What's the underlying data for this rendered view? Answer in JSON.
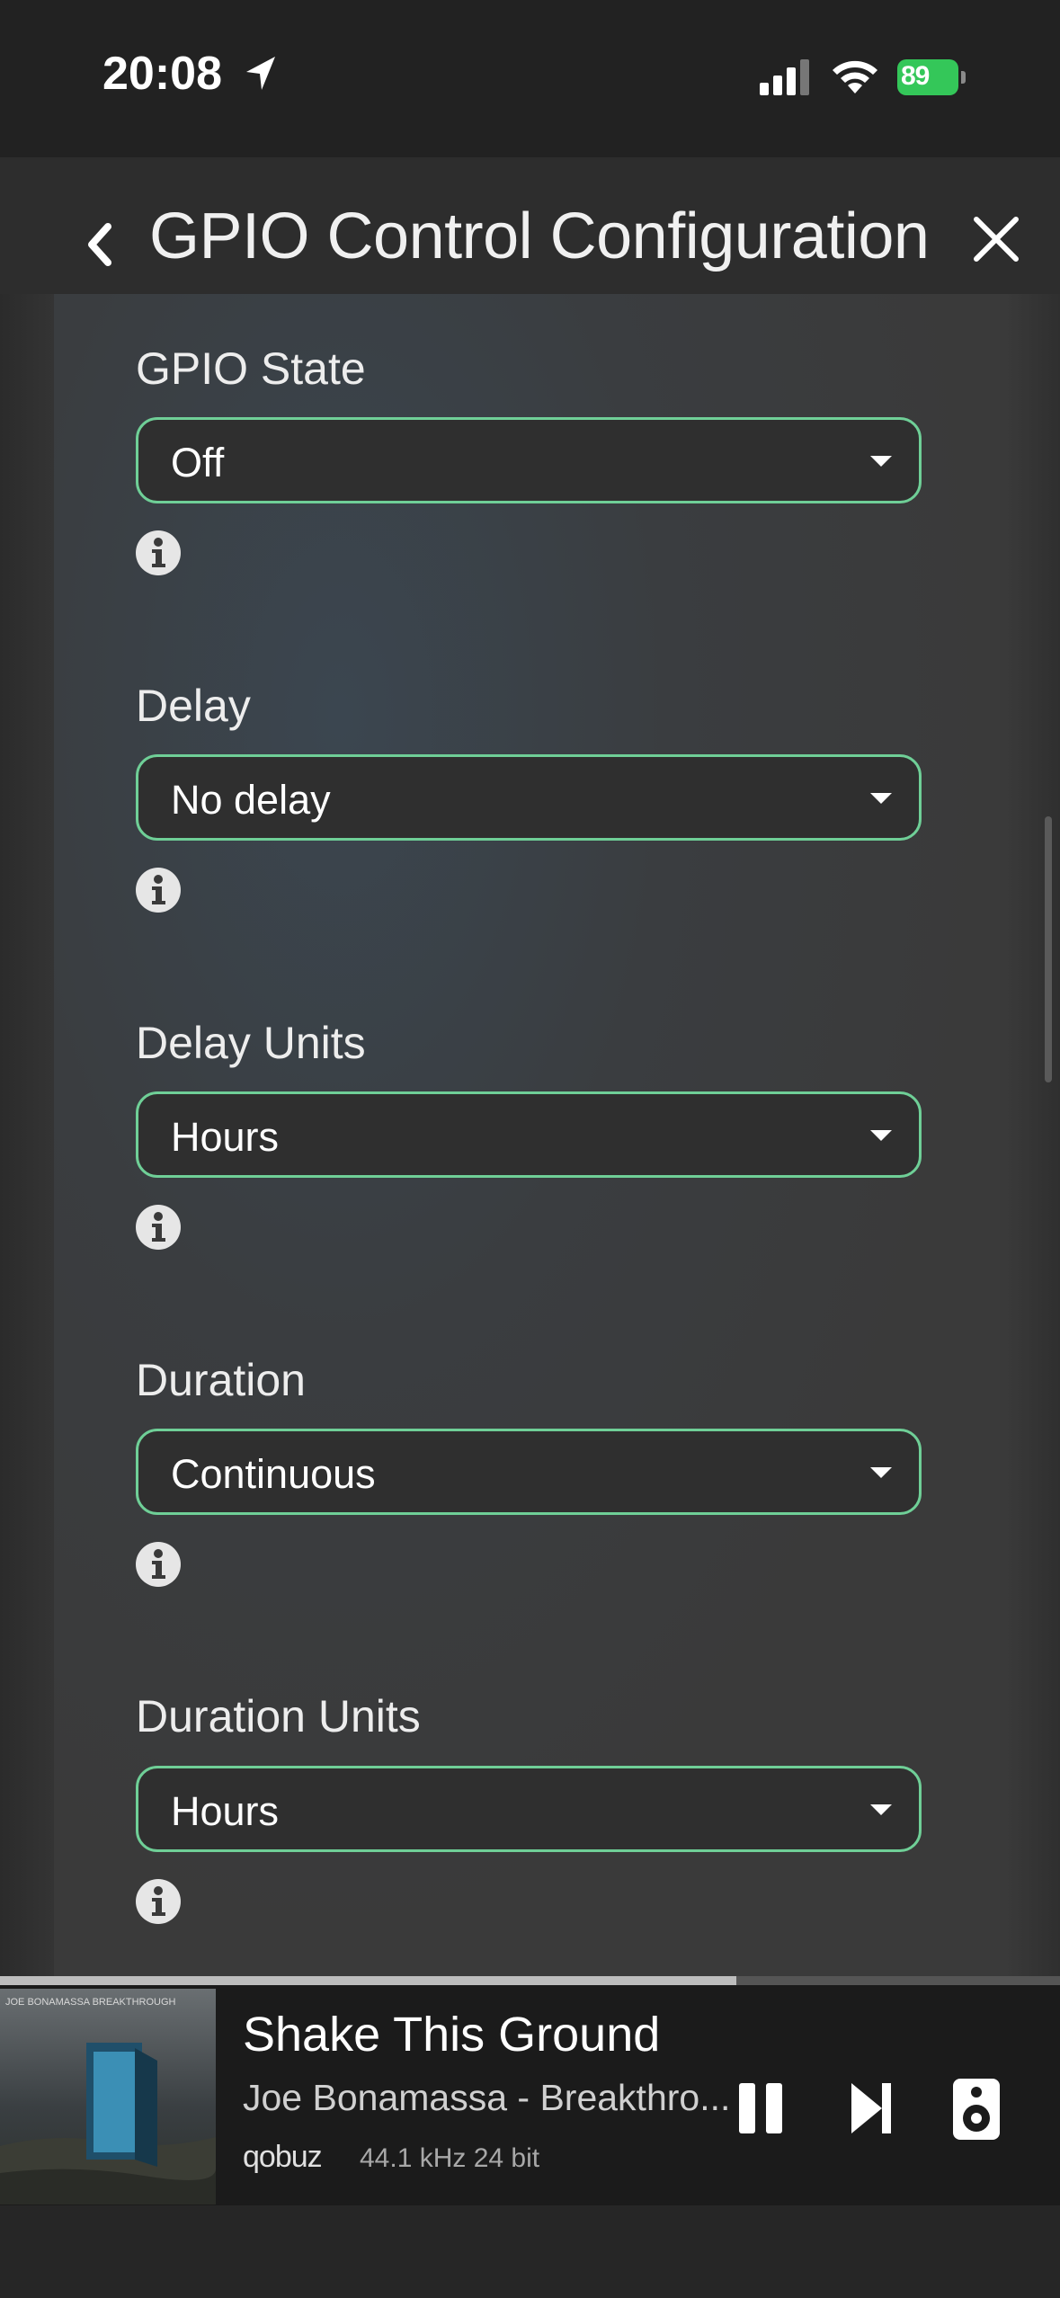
{
  "status_bar": {
    "time": "20:08",
    "battery": "89"
  },
  "header": {
    "title": "GPIO Control Configuration"
  },
  "fields": [
    {
      "label": "GPIO State",
      "value": "Off"
    },
    {
      "label": "Delay",
      "value": "No delay"
    },
    {
      "label": "Delay Units",
      "value": "Hours"
    },
    {
      "label": "Duration",
      "value": "Continuous"
    },
    {
      "label": "Duration Units",
      "value": "Hours"
    }
  ],
  "player": {
    "album_caption": "JOE BONAMASSA BREAKTHROUGH",
    "title": "Shake This Ground",
    "artist_album": "Joe Bonamassa - Breakthro...",
    "service": "qobuz",
    "quality": "44.1 kHz 24 bit",
    "progress": 0.695
  },
  "colors": {
    "accent": "#6fcf97",
    "battery": "#34c759"
  }
}
